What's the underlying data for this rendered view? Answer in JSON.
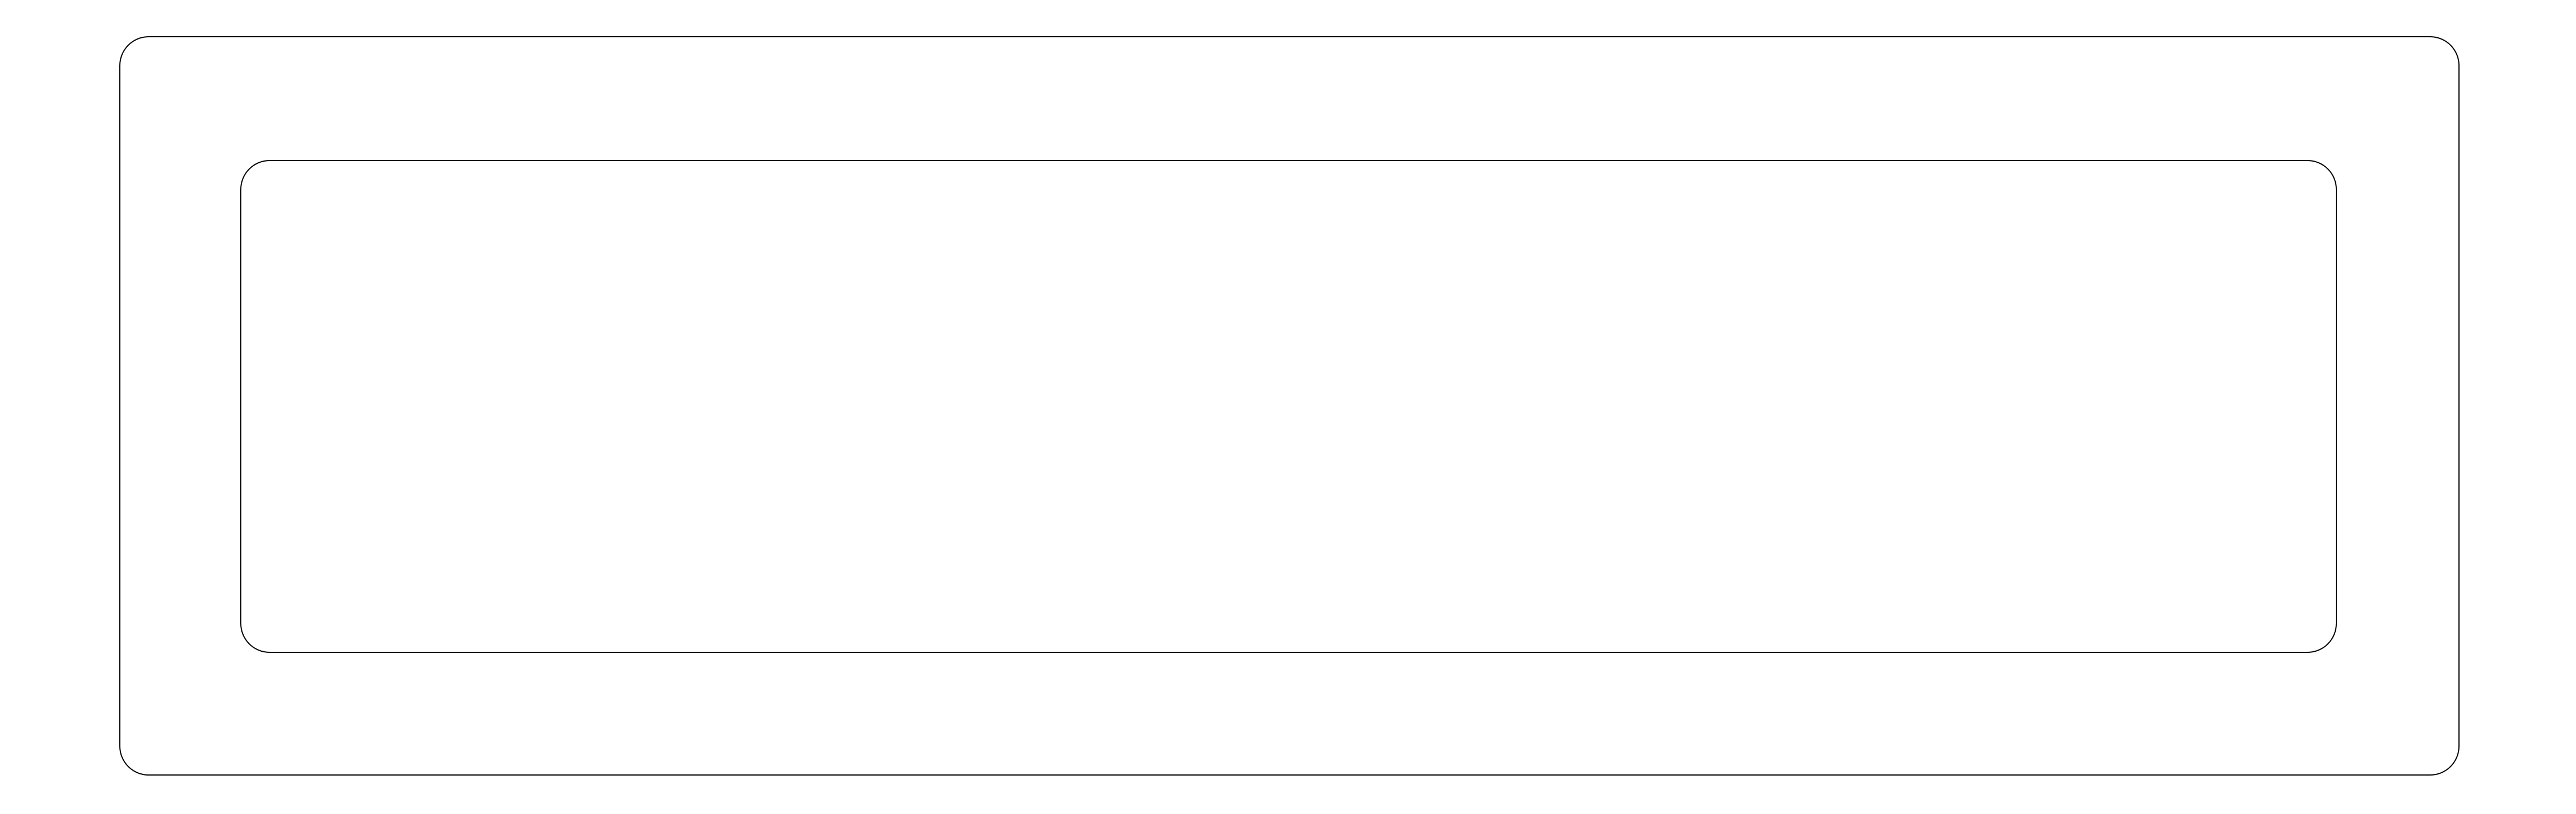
{
  "diagram": {
    "shapes": [
      {
        "name": "outer-rounded-rectangle",
        "stroke": "#000000",
        "fill": "#ffffff"
      },
      {
        "name": "inner-rounded-rectangle",
        "stroke": "#000000",
        "fill": "#ffffff"
      }
    ],
    "text": []
  }
}
